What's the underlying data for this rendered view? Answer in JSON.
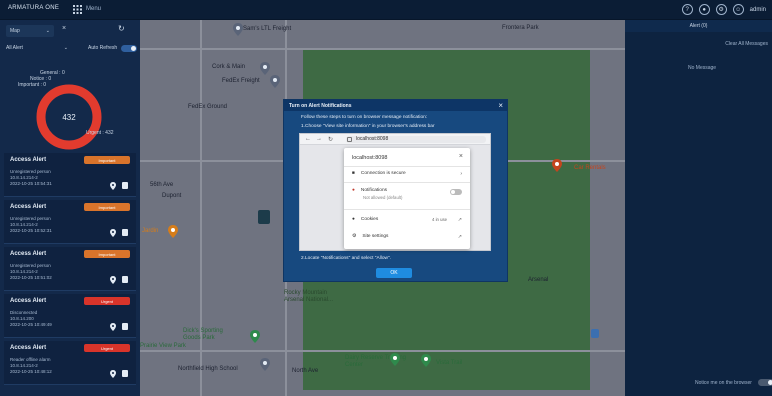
{
  "app": {
    "brand": "ARMATURA ONE",
    "menu_label": "Menu",
    "user": "admin"
  },
  "sidebar": {
    "map_select": "Map",
    "alert_filter": "All Alert",
    "auto_refresh_label": "Auto Refresh",
    "chart": {
      "total": "432",
      "labels": {
        "general": "General : 0",
        "notice": "Notice : 0",
        "important": "Important : 0",
        "urgent": "Urgent : 432"
      },
      "legend": [
        "Urgent",
        "Important",
        "General",
        "Notice"
      ],
      "legend_colors": [
        "#e23b2e",
        "#f0a020",
        "#e8c54a",
        "#2e7be6"
      ]
    },
    "alerts": [
      {
        "title": "Access Alert",
        "badge": "Important",
        "badge_color": "#d9742b",
        "lines": [
          "Unregistered person",
          "10.8.14.214-2",
          "2022-10-25 10:54:31"
        ]
      },
      {
        "title": "Access Alert",
        "badge": "Important",
        "badge_color": "#d9742b",
        "lines": [
          "Unregistered person",
          "10.8.14.214-2",
          "2022-10-25 10:52:31"
        ]
      },
      {
        "title": "Access Alert",
        "badge": "Important",
        "badge_color": "#d9742b",
        "lines": [
          "Unregistered person",
          "10.8.14.214-2",
          "2022-10-25 10:51:02"
        ]
      },
      {
        "title": "Access Alert",
        "badge": "Urgent",
        "badge_color": "#d8342a",
        "lines": [
          "Disconnected",
          "10.8.14.200",
          "2022-10-25 10:49:49"
        ]
      },
      {
        "title": "Access Alert",
        "badge": "Urgent",
        "badge_color": "#d8342a",
        "lines": [
          "Reader offline alarm",
          "10.8.14.214-2",
          "2022-10-25 10:48:12"
        ]
      }
    ]
  },
  "map": {
    "labels": {
      "sams": "Sam's LTL Freight",
      "frontera": "Frontera Park",
      "cork": "Cork & Main",
      "fedex_freight": "FedEx Freight",
      "fedex_ground": "FedEx Ground",
      "ave_56": "56th Ave",
      "dupont": "Dupont",
      "jardin": "Jardin",
      "rocky": "Rocky Mountain Arsenal National...",
      "dicks": "Dick's Sporting Goods Park",
      "prairie": "Prairie View Park",
      "northfield": "Northfield High School",
      "rental": "Car Rentals",
      "arsenal": "Arsenal",
      "vista": "Vista Trail",
      "dairy": "Dairy Reserve Training Center",
      "north_ave": "North Ave"
    }
  },
  "right_panel": {
    "header": "Alert (0)",
    "link": "Clear All Messages",
    "no_message": "No Message",
    "footer": "Notice me on the browser"
  },
  "modal": {
    "title": "Turn on Alert Notifications",
    "intro": "Follow these steps to turn on browser message notification:",
    "step1": "1.Choose \"View site information\" in your browser's address bar",
    "url": "localhost:8098",
    "popup_host": "localhost:8098",
    "connection": "Connection is secure",
    "notifications": "Notifications",
    "notifications_sub": "Not allowed (default)",
    "cookies": "Cookies",
    "cookies_count": "4 in use",
    "site_settings": "Site settings",
    "step2": "2.Locate \"Notifications\" and select \"Allow\".",
    "ok": "OK"
  }
}
